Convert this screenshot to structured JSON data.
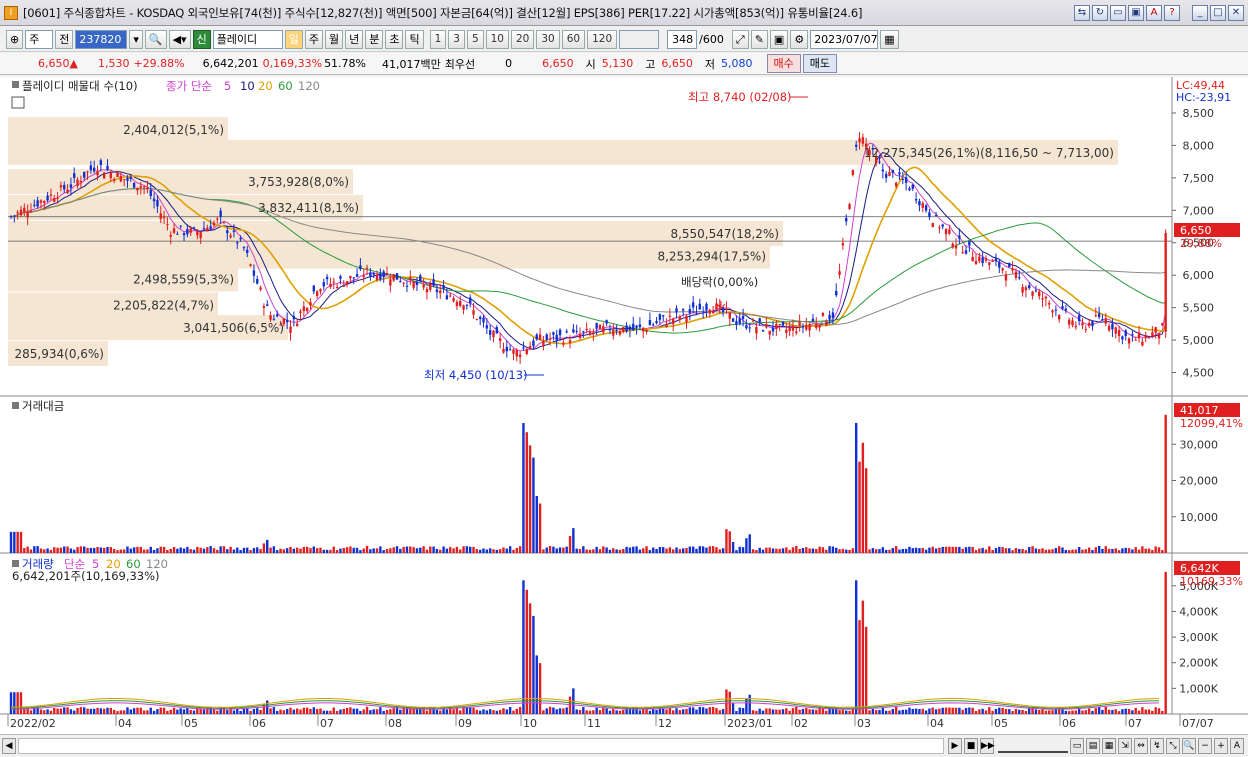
{
  "window": {
    "title": "[0601] 주식종합차트 - KOSDAQ 외국인보유[74(천)] 주식수[12,827(천)] 액면[500] 자본금[64(억)] 결산[12월] EPS[386] PER[17.22] 시가총액[853(억)] 유통비율[24.6]"
  },
  "toolbar": {
    "type_sel": "주",
    "prev": "전",
    "code": "237820",
    "name": "플레이디",
    "badge": "신",
    "periods": [
      "일",
      "주",
      "월",
      "년",
      "분",
      "초",
      "틱"
    ],
    "active_period": "일",
    "nums": [
      "1",
      "3",
      "5",
      "10",
      "20",
      "30",
      "60",
      "120"
    ],
    "count": "348",
    "total": "/600",
    "date": "2023/07/07"
  },
  "quote": {
    "price": "6,650",
    "arrow": "▲",
    "change": "1,530",
    "pct": "+29.88%",
    "volume": "6,642,201",
    "vol_ratio": "0,169,33%",
    "ratio2": "51.78%",
    "amount": "41,017백만",
    "bidask_label": "최우선",
    "bidask": "0",
    "ask": "6,650",
    "open_label": "시",
    "open": "5,130",
    "high_label": "고",
    "high": "6,650",
    "low_label": "저",
    "low": "5,080",
    "buy": "매수",
    "sell": "매도"
  },
  "panel1": {
    "legend_name": "플레이디 매물대 수(10)",
    "ma_label": "종가 단순",
    "ma": [
      "5",
      "10",
      "20",
      "60",
      "120"
    ],
    "lc": "LC:49,44",
    "hc": "HC:-23,91",
    "high_marker": "최고 8,740 (02/08)",
    "low_marker": "최저 4,450 (10/13)",
    "dividend": "배당락(0,00%)",
    "price_tag": "6,650",
    "pct_tag": "29,88%"
  },
  "panel2": {
    "title": "거래대금",
    "value_tag": "41,017",
    "value_tag2": "12099,41%"
  },
  "panel3": {
    "title": "거래량",
    "ma_label": "단순",
    "ma": [
      "5",
      "20",
      "60",
      "120"
    ],
    "sub": "6,642,201주(10,169,33%)",
    "value_tag": "6,642K",
    "value_tag2": "10169,33%"
  },
  "colors": {
    "up": "#e02020",
    "down": "#1030d0",
    "ma5": "#d040d0",
    "ma10": "#1a1a80",
    "ma20": "#e0a000",
    "ma60": "#2a9a3a",
    "ma120": "#888888",
    "band": "#f5e6d3"
  },
  "chart_data": {
    "type": "candlestick",
    "x_axis": [
      "2022/02",
      "04",
      "05",
      "06",
      "07",
      "08",
      "09",
      "10",
      "11",
      "12",
      "2023/01",
      "02",
      "03",
      "04",
      "05",
      "06",
      "07",
      "07/07"
    ],
    "price_ticks": [
      "8,500",
      "8,000",
      "7,500",
      "7,000",
      "6,500",
      "6,000",
      "5,500",
      "5,000",
      "4,500"
    ],
    "volume_profile": [
      {
        "label": "2,404,012(5,1%)",
        "price": 8250
      },
      {
        "label": "12,275,345(26,1%)(8,116,50 ~ 7,713,00)",
        "price": 7900
      },
      {
        "label": "3,753,928(8,0%)",
        "price": 7450
      },
      {
        "label": "3,832,411(8,1%)",
        "price": 7050
      },
      {
        "label": "8,550,547(18,2%)",
        "price": 6650
      },
      {
        "label": "8,253,294(17,5%)",
        "price": 6300
      },
      {
        "label": "2,498,559(5,3%)",
        "price": 5950
      },
      {
        "label": "2,205,822(4,7%)",
        "price": 5550
      },
      {
        "label": "3,041,506(6,5%)",
        "price": 5200
      },
      {
        "label": "285,934(0,6%)",
        "price": 4800
      }
    ],
    "amount_ticks": [
      "30,000",
      "20,000",
      "10,000"
    ],
    "volume_ticks": [
      "5,000K",
      "4,000K",
      "3,000K",
      "2,000K",
      "1,000K"
    ]
  }
}
